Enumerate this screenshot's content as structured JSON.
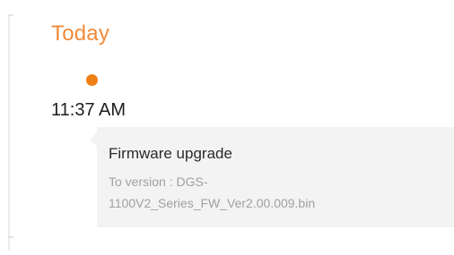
{
  "timeline": {
    "day_heading": "Today",
    "accent_color": "#f08a3a",
    "dot_color": "#f07f16",
    "events": [
      {
        "time": "11:37 AM",
        "title": "Firmware upgrade",
        "detail_line_1": "To version : DGS-",
        "detail_line_2": "1100V2_Series_FW_Ver2.00.009.bin"
      }
    ]
  }
}
